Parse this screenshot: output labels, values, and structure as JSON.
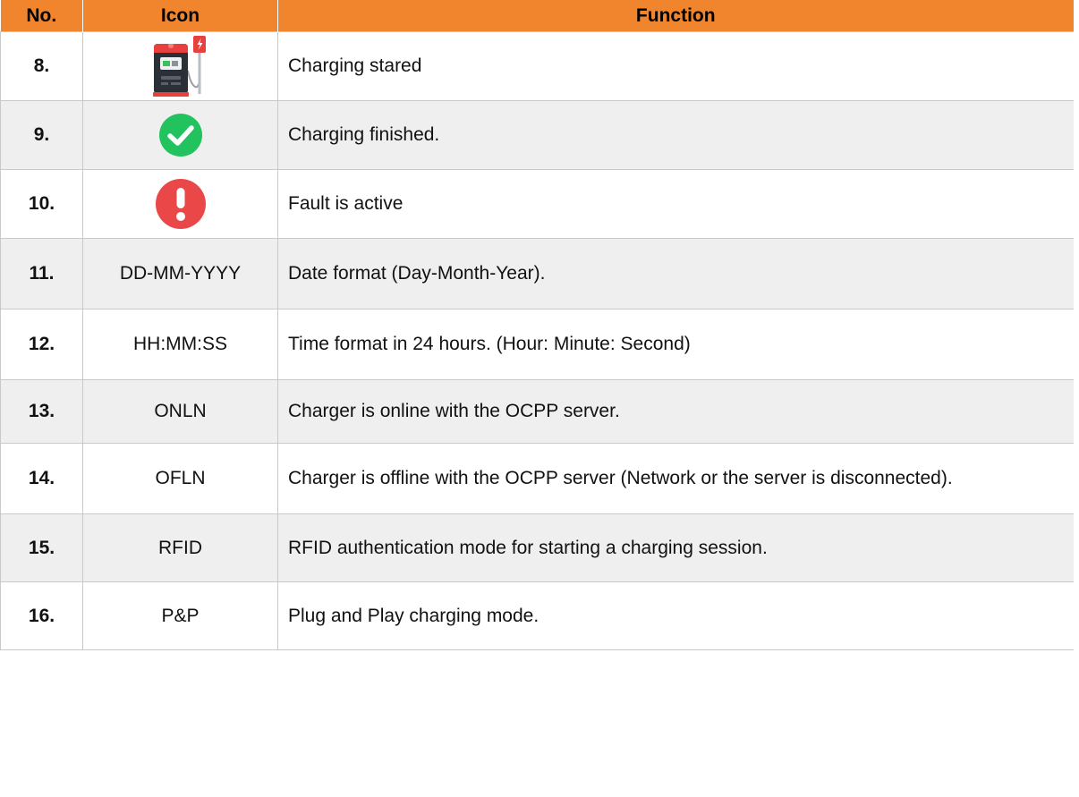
{
  "table": {
    "headers": {
      "no": "No.",
      "icon": "Icon",
      "function": "Function"
    },
    "rows": [
      {
        "no": "8.",
        "icon_name": "charging-station-icon",
        "icon_text": "",
        "function": "Charging stared"
      },
      {
        "no": "9.",
        "icon_name": "green-check-circle-icon",
        "icon_text": "",
        "function": "Charging finished."
      },
      {
        "no": "10.",
        "icon_name": "red-exclamation-circle-icon",
        "icon_text": "",
        "function": "Fault is active"
      },
      {
        "no": "11.",
        "icon_name": "",
        "icon_text": "DD-MM-YYYY",
        "function": "Date format (Day-Month-Year)."
      },
      {
        "no": "12.",
        "icon_name": "",
        "icon_text": "HH:MM:SS",
        "function": "Time format in 24 hours. (Hour: Minute: Second)"
      },
      {
        "no": "13.",
        "icon_name": "",
        "icon_text": "ONLN",
        "function": "Charger is online with the OCPP server."
      },
      {
        "no": "14.",
        "icon_name": "",
        "icon_text": "OFLN",
        "function": "Charger is offline with the OCPP server (Network or the server is disconnected)."
      },
      {
        "no": "15.",
        "icon_name": "",
        "icon_text": "RFID",
        "function": "RFID authentication mode for starting a charging session."
      },
      {
        "no": "16.",
        "icon_name": "",
        "icon_text": "P&P",
        "function": "Plug and Play charging mode."
      }
    ]
  },
  "colors": {
    "header_bg": "#f0852d",
    "row_alt_bg": "#efefef",
    "grid": "#c9c9c9",
    "check_green": "#22c25e",
    "fault_red": "#ea4848",
    "charger_red": "#e8403c",
    "charger_body": "#2b2f36"
  }
}
